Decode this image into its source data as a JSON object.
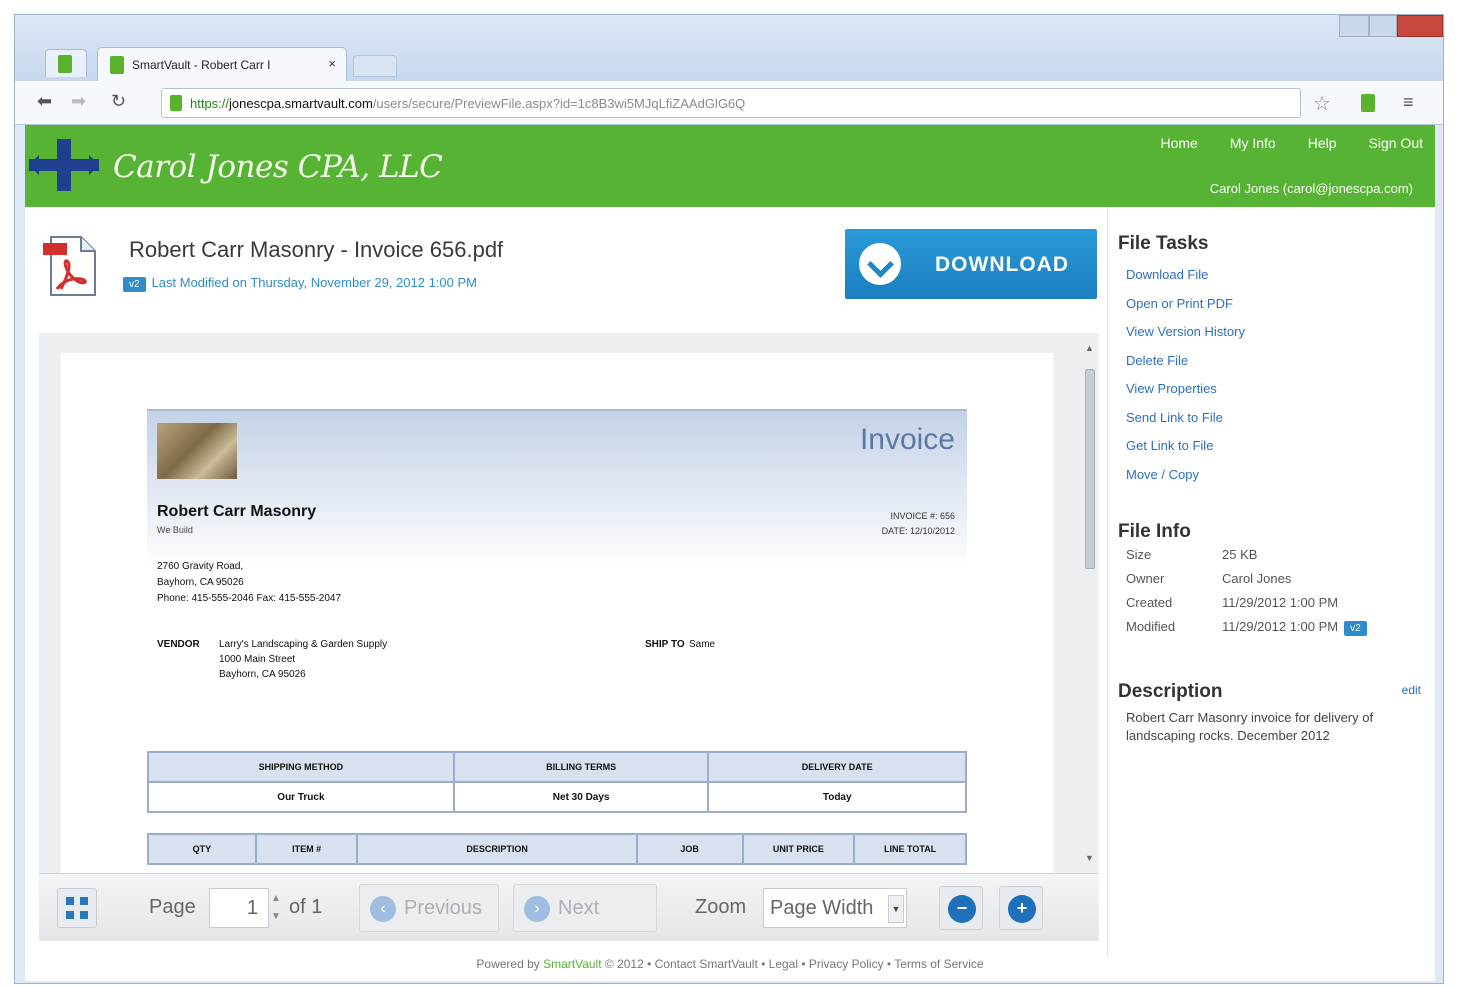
{
  "browser": {
    "tab_title": "SmartVault - Robert Carr I",
    "tab_close": "×",
    "url_secure": "https://",
    "url_host": "jonescpa.smartvault.com",
    "url_path": "/users/secure/PreviewFile.aspx?id=1c8B3wi5MJqLfiZAAdGlG6Q",
    "icons": [
      "back-icon",
      "forward-icon",
      "reload-icon",
      "lock-icon",
      "star-icon",
      "menu-icon"
    ]
  },
  "header": {
    "logo_text": "Carol Jones CPA, LLC",
    "nav": [
      "Home",
      "My Info",
      "Help",
      "Sign Out"
    ],
    "user": "Carol Jones (carol@jonescpa.com)",
    "color": "#56b333"
  },
  "file": {
    "name": "Robert Carr Masonry - Invoice 656.pdf",
    "version_badge": "v2",
    "modified": "Last Modified on Thursday, November 29, 2012 1:00 PM",
    "download_label": "DOWNLOAD",
    "pdf_badge": "PDF"
  },
  "invoice": {
    "title": "Invoice",
    "company": "Robert Carr Masonry",
    "motto": "We Build",
    "meta": [
      "INVOICE #: 656",
      "DATE: 12/10/2012"
    ],
    "address": [
      "2760 Gravity Road,",
      "Bayhorn, CA 95026",
      "Phone: 415-555-2046 Fax: 415-555-2047"
    ],
    "vendor_label": "VENDOR",
    "vendor_lines": [
      "Larry's Landscaping & Garden Supply",
      "1000 Main Street",
      "Bayhorn, CA 95026"
    ],
    "ship_label": "SHIP TO",
    "ship_value": "Same",
    "table1_headers": [
      "SHIPPING METHOD",
      "BILLING TERMS",
      "DELIVERY DATE"
    ],
    "table1_values": [
      "Our Truck",
      "Net 30 Days",
      "Today"
    ],
    "table2_headers": [
      "QTY",
      "ITEM #",
      "DESCRIPTION",
      "JOB",
      "UNIT PRICE",
      "LINE TOTAL"
    ]
  },
  "pager": {
    "page_label": "Page",
    "page_value": "1",
    "of_label": "of 1",
    "previous": "Previous",
    "next": "Next",
    "zoom_label": "Zoom",
    "zoom_value": "Page Width",
    "zoom_out": "−",
    "zoom_in": "+"
  },
  "sidebar": {
    "tasks_title": "File Tasks",
    "tasks": [
      "Download File",
      "Open or Print PDF",
      "View Version History",
      "Delete File",
      "View Properties",
      "Send Link to File",
      "Get Link to File",
      "Move / Copy"
    ],
    "info_title": "File Info",
    "info": [
      {
        "k": "Size",
        "v": "25 KB"
      },
      {
        "k": "Owner",
        "v": "Carol Jones"
      },
      {
        "k": "Created",
        "v": "11/29/2012 1:00 PM"
      },
      {
        "k": "Modified",
        "v": "11/29/2012 1:00 PM"
      }
    ],
    "info_badge": "v2",
    "desc_title": "Description",
    "desc_edit": "edit",
    "description": "Robert Carr Masonry invoice for delivery of landscaping rocks. December 2012"
  },
  "footer": {
    "prefix": "Powered by ",
    "brand": "SmartVault",
    "rest": " © 2012  •  Contact SmartVault  •  Legal  •  Privacy Policy  •  Terms of Service"
  }
}
